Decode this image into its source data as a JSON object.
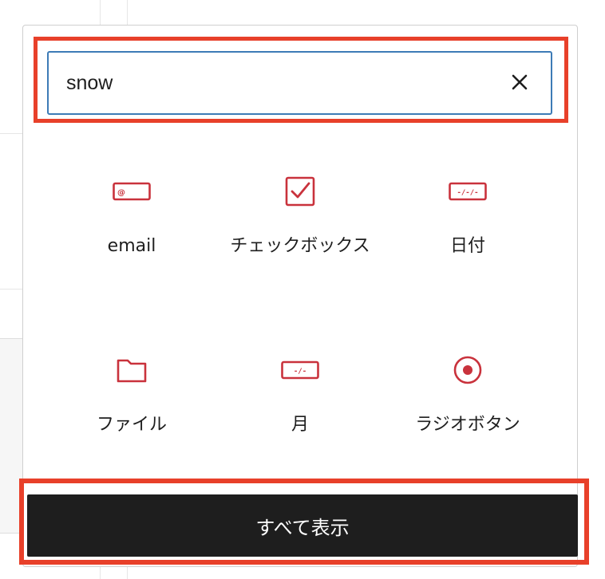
{
  "search": {
    "value": "snow",
    "clear_icon": "close-icon"
  },
  "blocks": [
    {
      "label": "email",
      "icon": "email-field-icon"
    },
    {
      "label": "チェックボックス",
      "icon": "checkbox-icon"
    },
    {
      "label": "日付",
      "icon": "date-field-icon"
    },
    {
      "label": "ファイル",
      "icon": "folder-icon"
    },
    {
      "label": "月",
      "icon": "month-field-icon"
    },
    {
      "label": "ラジオボタン",
      "icon": "radio-button-icon"
    }
  ],
  "footer": {
    "show_all_label": "すべて表示"
  },
  "colors": {
    "icon_accent": "#c9323c",
    "highlight": "#e8402a",
    "focus_border": "#3d7bb6",
    "button_bg": "#1e1e1e"
  }
}
